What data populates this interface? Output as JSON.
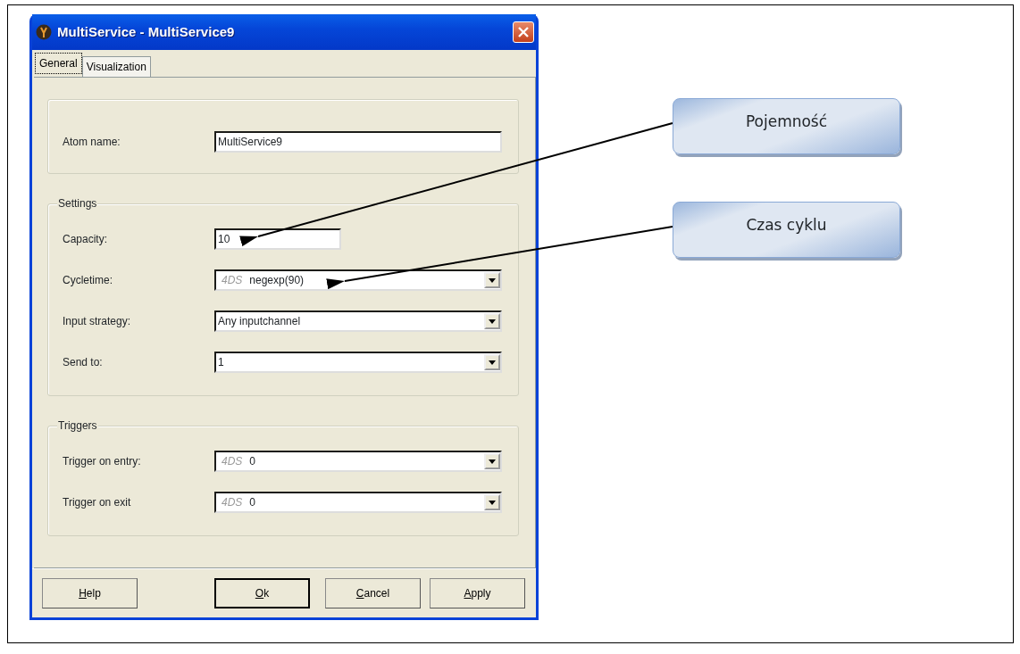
{
  "window": {
    "title": "MultiService - MultiService9"
  },
  "tabs": [
    {
      "label": "General",
      "selected": true
    },
    {
      "label": "Visualization",
      "selected": false
    }
  ],
  "groups": [
    {
      "fields": [
        {
          "kind": "text",
          "label": "Atom name:",
          "value": "MultiService9",
          "wide": true
        }
      ]
    },
    {
      "legend": "Settings",
      "fields": [
        {
          "kind": "text",
          "label": "Capacity:",
          "value": "10",
          "wide": false
        },
        {
          "kind": "combo",
          "label": "Cycletime:",
          "prefix": "4DS",
          "value": "negexp(90)"
        },
        {
          "kind": "combo",
          "label": "Input strategy:",
          "value": "Any inputchannel"
        },
        {
          "kind": "combo",
          "label": "Send to:",
          "value": "1"
        }
      ]
    },
    {
      "legend": "Triggers",
      "fields": [
        {
          "kind": "combo",
          "label": "Trigger on entry:",
          "prefix": "4DS",
          "value": "0"
        },
        {
          "kind": "combo",
          "label": "Trigger on exit",
          "prefix": "4DS",
          "value": "0"
        }
      ]
    }
  ],
  "buttons": [
    {
      "label": "Help",
      "mnemonic": true,
      "default": false
    },
    {
      "label": "Ok",
      "mnemonic": true,
      "default": true
    },
    {
      "label": "Cancel",
      "mnemonic": true,
      "default": false
    },
    {
      "label": "Apply",
      "mnemonic": true,
      "default": false
    }
  ],
  "callouts": [
    {
      "text": "Pojemność"
    },
    {
      "text": "Czas cyklu"
    }
  ]
}
